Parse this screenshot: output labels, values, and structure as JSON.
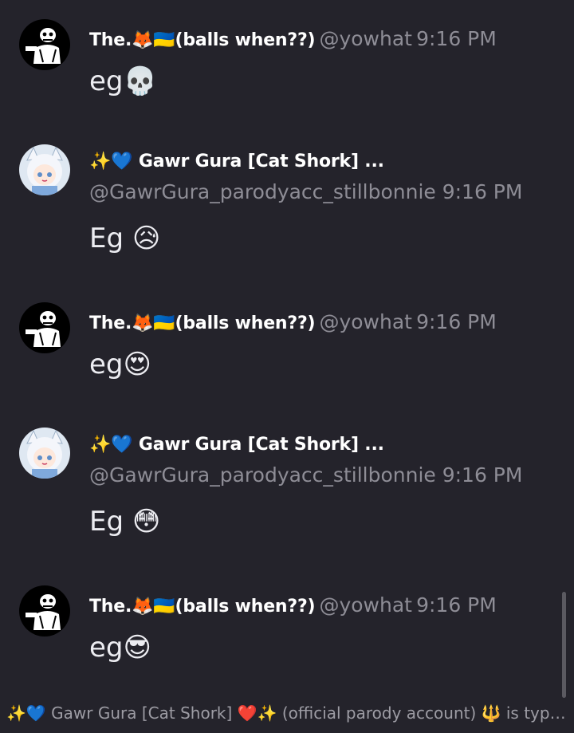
{
  "messages": [
    {
      "avatar": "sans-skeleton-avatar",
      "username": "The.🦊🇺🇦(balls when??)",
      "handle": "@yowhat",
      "time": "9:16 PM",
      "content": "eg💀"
    },
    {
      "avatar": "gura-anime-avatar",
      "username": "✨💙 Gawr Gura [Cat Shork] ...",
      "handle": "@GawrGura_parodyacc_stillbonnie",
      "time": "9:16 PM",
      "content": "Eg 😥"
    },
    {
      "avatar": "sans-skeleton-avatar",
      "username": "The.🦊🇺🇦(balls when??)",
      "handle": "@yowhat",
      "time": "9:16 PM",
      "content": "eg😍"
    },
    {
      "avatar": "gura-anime-avatar",
      "username": "✨💙 Gawr Gura [Cat Shork] ...",
      "handle": "@GawrGura_parodyacc_stillbonnie",
      "time": "9:16 PM",
      "content": "Eg 😳"
    },
    {
      "avatar": "sans-skeleton-avatar",
      "username": "The.🦊🇺🇦(balls when??)",
      "handle": "@yowhat",
      "time": "9:16 PM",
      "content": "eg😎"
    }
  ],
  "typing_indicator": "✨💙 Gawr Gura [Cat Shork] ❤️✨ (official parody account) 🔱 is typi...",
  "colors": {
    "background": "#24232b",
    "username": "#ffffff",
    "muted": "#8e8d96",
    "message_text": "#ececf1"
  }
}
